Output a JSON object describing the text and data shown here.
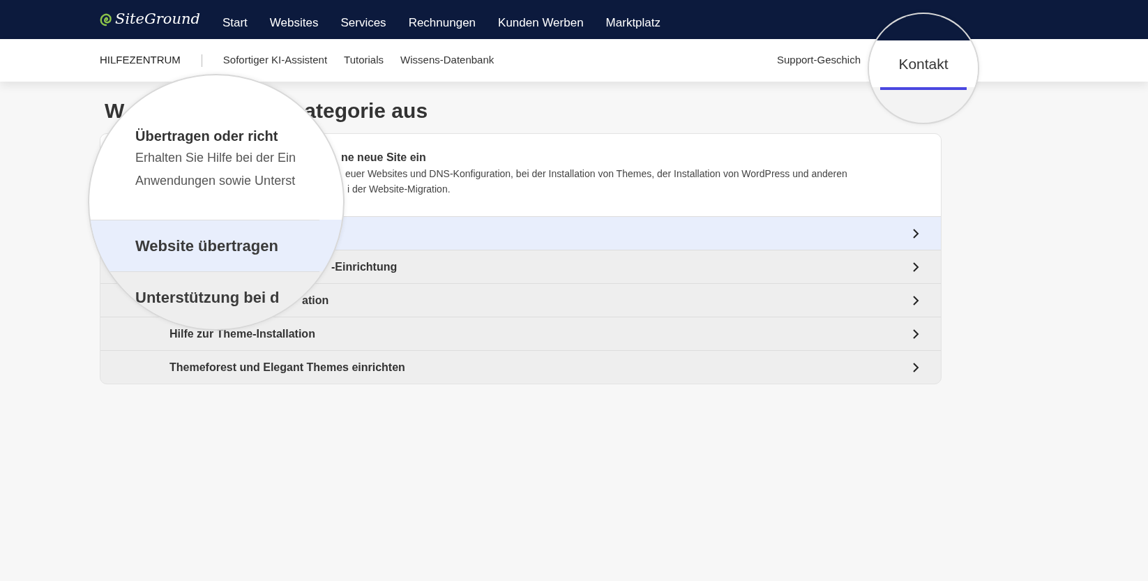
{
  "top_nav": {
    "logo": "SiteGround",
    "items": [
      "Start",
      "Websites",
      "Services",
      "Rechnungen",
      "Kunden Werben",
      "Marktplatz"
    ]
  },
  "sub_nav": {
    "title": "HILFEZENTRUM",
    "links": [
      "Sofortiger KI-Assistent",
      "Tutorials",
      "Wissens-Datenbank"
    ],
    "right_link": "Support-Geschich"
  },
  "heading_fragments": [
    "W",
    "ategorie aus"
  ],
  "card": {
    "title_fragment": "ne neue Site ein",
    "description_fragments": [
      "euer Websites und DNS-Konfiguration, bei der Installation von Themes, der Installation von WordPress und anderen",
      "i der Website-Migration."
    ],
    "rows": [
      {
        "selected": true
      },
      {
        "label": "-Einrichtung",
        "kind": "partial",
        "selected": false
      },
      {
        "label": "ation",
        "kind": "partial",
        "selected": false
      },
      {
        "label": "Hilfe zur Theme-Installation",
        "kind": "full",
        "selected": false
      },
      {
        "label": "Themeforest und Elegant Themes einrichten",
        "kind": "full",
        "selected": false
      }
    ]
  },
  "magnifiers": [
    {
      "kind": "content",
      "title": "Übertragen oder richt",
      "description_lines": [
        "Erhalten Sie Hilfe bei der Ein",
        "Anwendungen sowie Unterst"
      ],
      "rows": [
        {
          "label": "Website übertragen",
          "selected": true
        },
        {
          "label": "Unterstützung bei d",
          "selected": false
        }
      ]
    },
    {
      "kind": "tab",
      "label": "Kontakt",
      "selected": true
    }
  ]
}
